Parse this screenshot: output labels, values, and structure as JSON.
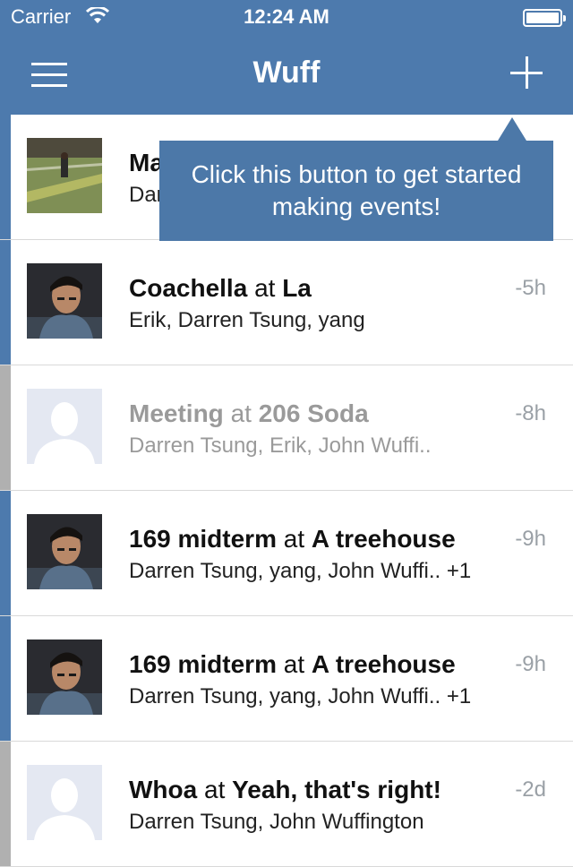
{
  "status": {
    "carrier": "Carrier",
    "time": "12:24 AM"
  },
  "nav": {
    "title": "Wuff",
    "menu_icon": "hamburger-menu-icon",
    "add_icon": "plus-icon"
  },
  "tooltip": {
    "line1": "Click this button to get started",
    "line2": "making events!"
  },
  "events": [
    {
      "name": "Ma",
      "place": "",
      "people": "Dar",
      "ago": "",
      "accent": "#4d7aad",
      "avatar": "field-photo",
      "muted": false
    },
    {
      "name": "Coachella",
      "place": "La",
      "people": "Erik, Darren Tsung, yang",
      "ago": "-5h",
      "accent": "#4d7aad",
      "avatar": "person-photo",
      "muted": false
    },
    {
      "name": "Meeting",
      "place": "206 Soda",
      "people": "Darren Tsung, Erik, John Wuffi..",
      "ago": "-8h",
      "accent": "#b0b0b0",
      "avatar": "placeholder-avatar",
      "muted": true
    },
    {
      "name": "169 midterm",
      "place": "A treehouse",
      "people": "Darren Tsung, yang, John Wuffi.. +1",
      "ago": "-9h",
      "accent": "#4d7aad",
      "avatar": "person-photo",
      "muted": false
    },
    {
      "name": "169 midterm",
      "place": "A treehouse",
      "people": "Darren Tsung, yang, John Wuffi.. +1",
      "ago": "-9h",
      "accent": "#4d7aad",
      "avatar": "person-photo",
      "muted": false
    },
    {
      "name": "Whoa",
      "place": "Yeah, that's right!",
      "people": "Darren Tsung, John Wuffington",
      "ago": "-2d",
      "accent": "#b0b0b0",
      "avatar": "placeholder-avatar",
      "muted": false
    }
  ],
  "connector": "at"
}
